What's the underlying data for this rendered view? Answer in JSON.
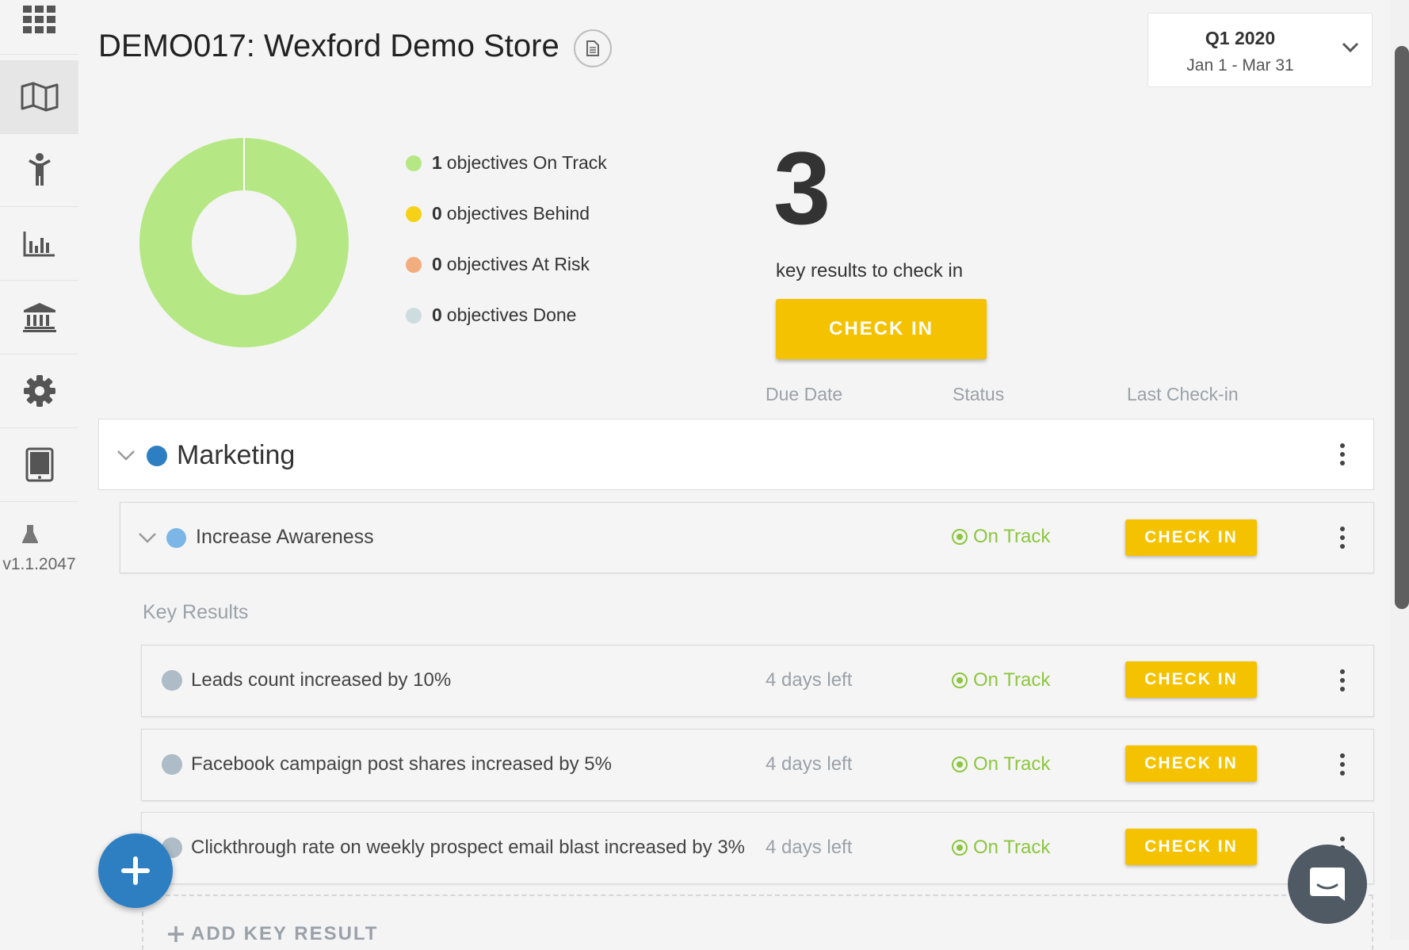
{
  "header": {
    "title": "DEMO017: Wexford Demo Store",
    "period_title": "Q1 2020",
    "period_range": "Jan 1 - Mar 31"
  },
  "sidebar": {
    "items": [
      "apps-grid-icon",
      "map-icon",
      "person-icon",
      "bar-chart-icon",
      "institution-icon",
      "gear-icon",
      "tablet-icon"
    ],
    "version": "v1.1.2047"
  },
  "summary": {
    "legend": [
      {
        "count": "1",
        "label": "objectives On Track",
        "color": "#b5e885"
      },
      {
        "count": "0",
        "label": "objectives Behind",
        "color": "#f7d117"
      },
      {
        "count": "0",
        "label": "objectives At Risk",
        "color": "#f2ad7e"
      },
      {
        "count": "0",
        "label": "objectives Done",
        "color": "#cfdcdf"
      }
    ],
    "donut": {
      "on_track": 1,
      "behind": 0,
      "at_risk": 0,
      "done": 0
    },
    "kr_count": "3",
    "kr_label": "key results to check in",
    "check_in_label": "CHECK IN"
  },
  "columns": {
    "due_date": "Due Date",
    "status": "Status",
    "last_checkin": "Last Check-in"
  },
  "team": {
    "name": "Marketing",
    "color": "#2d7fc2"
  },
  "objective": {
    "name": "Increase Awareness",
    "status": "On Track",
    "check_in_label": "CHECK IN",
    "color": "#7bb6e6"
  },
  "key_results_label": "Key Results",
  "key_results": [
    {
      "name": "Leads count increased by 10%",
      "due": "4 days left",
      "status": "On Track",
      "check_in_label": "CHECK IN"
    },
    {
      "name": "Facebook campaign post shares increased by 5%",
      "due": "4 days left",
      "status": "On Track",
      "check_in_label": "CHECK IN"
    },
    {
      "name": "Clickthrough rate on weekly prospect email blast increased by 3%",
      "due": "4 days left",
      "status": "On Track",
      "check_in_label": "CHECK IN"
    }
  ],
  "add_key_result_label": "ADD KEY RESULT",
  "colors": {
    "accent": "#f5c200",
    "on_track": "#8cc63f",
    "fab": "#2d7fc2"
  }
}
